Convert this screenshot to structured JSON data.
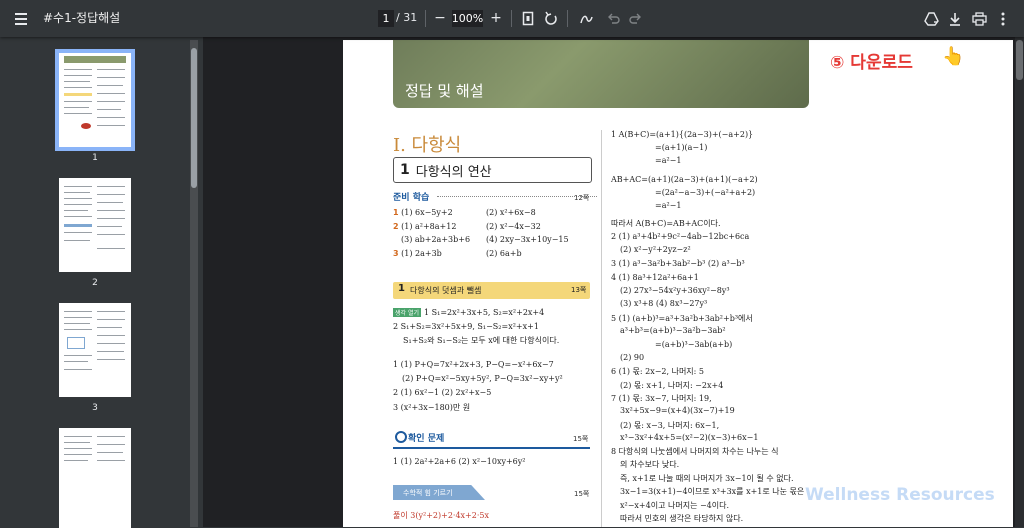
{
  "toolbar": {
    "title": "#수1-정답해설",
    "page_current": "1",
    "page_total": "/ 31",
    "zoom_minus": "−",
    "zoom_value": "100%",
    "zoom_plus": "+",
    "icons": [
      "menu-icon",
      "fit-page-icon",
      "rotate-icon",
      "annotate-icon",
      "undo-icon",
      "redo-icon",
      "drive-icon",
      "download-icon",
      "print-icon",
      "more-icon"
    ]
  },
  "sidebar": {
    "thumbnails": [
      {
        "label": "1",
        "selected": true
      },
      {
        "label": "2",
        "selected": false
      },
      {
        "label": "3",
        "selected": false
      },
      {
        "label": ""
      }
    ]
  },
  "page": {
    "banner": "정답 및 해설",
    "chapter": "I. 다항식",
    "section_num": "1",
    "section_title": "다항식의 연산",
    "prep_label": "준비 학습",
    "prep_page": "12쪽",
    "left_answers": [
      {
        "n": "1",
        "a": "(1) 6x−5y+2",
        "b": "(2) x²+6x−8"
      },
      {
        "n": "2",
        "a": "(1) a²+8a+12",
        "b": "(2) x²−4x−32"
      },
      {
        "n": "",
        "a": "(3) ab+2a+3b+6",
        "b": "(4) 2xy−3x+10y−15"
      },
      {
        "n": "3",
        "a": "(1) 2a+3b",
        "b": "(2) 6a+b"
      }
    ],
    "sub_num": "1",
    "sub_title": "다항식의 덧셈과 뺄셈",
    "sub_page": "13쪽",
    "think_tag": "생각 열기",
    "think_lines": [
      "1  S₁=2x²+3x+5, S₂=x²+2x+4",
      "2  S₁+S₂=3x²+5x+9, S₁−S₂=x²+x+1",
      "S₁+S₂와 S₁−S₂는 모두 x에 대한 다항식이다."
    ],
    "sub_answers": [
      "1  (1) P+Q=7x²+2x+3, P−Q=−x²+6x−7",
      "(2) P+Q=x²−5xy+5y², P−Q=3x²−xy+y²",
      "2  (1) 6x²−1          (2) 2x²+x−5",
      "3  (x²+3x−180)만 원"
    ],
    "check_title": "확인 문제",
    "check_page": "15쪽",
    "check_answer": "1  (1) 2a²+2a+6          (2) x²−10xy+6y²",
    "math_tag": "수학적 힘 기르기",
    "math_page": "15쪽",
    "math_line": "풀이 3(y²+2)+2·4x+2·5x",
    "right_lines": [
      "1  A(B+C)=(a+1){(2a−3)+(−a+2)}",
      "=(a+1)(a−1)",
      "=a²−1",
      "AB+AC=(a+1)(2a−3)+(a+1)(−a+2)",
      "=(2a²−a−3)+(−a²+a+2)",
      "=a²−1",
      "따라서 A(B+C)=AB+AC이다.",
      "2  (1) a³+4b²+9c²−4ab−12bc+6ca",
      "(2) x²−y²+2yz−z²",
      "3  (1) a³−3a²b+3ab²−b³        (2) a³−b³",
      "4  (1) 8a³+12a²+6a+1",
      "(2) 27x³−54x²y+36xy²−8y³",
      "(3) x³+8                         (4) 8x³−27y³",
      "5  (1) (a+b)³=a³+3a²b+3ab²+b³에서",
      "a³+b³=(a+b)³−3a²b−3ab²",
      "=(a+b)³−3ab(a+b)",
      "(2) 90",
      "6  (1) 몫: 2x−2, 나머지: 5",
      "(2) 몫: x+1, 나머지: −2x+4",
      "7  (1) 몫: 3x−7, 나머지: 19,",
      "3x²+5x−9=(x+4)(3x−7)+19",
      "(2) 몫: x−3, 나머지: 6x−1,",
      "x³−3x²+4x+5=(x²−2)(x−3)+6x−1",
      "8  다항식의 나눗셈에서 나머지의 차수는 나누는 식",
      "의 차수보다 낮다.",
      "즉, x+1로 나눌 때의 나머지가 3x−1이 될 수 없다.",
      "3x−1=3(x+1)−4이므로 x³+3x를 x+1로 나눈 몫은",
      "x²−x+4이고 나머지는 −4이다.",
      "따라서 민호의 생각은 타당하지 않다."
    ]
  },
  "overlay": {
    "step": "⑤ 다운로드",
    "hand": "👆",
    "watermark": "Wellness Resources"
  }
}
